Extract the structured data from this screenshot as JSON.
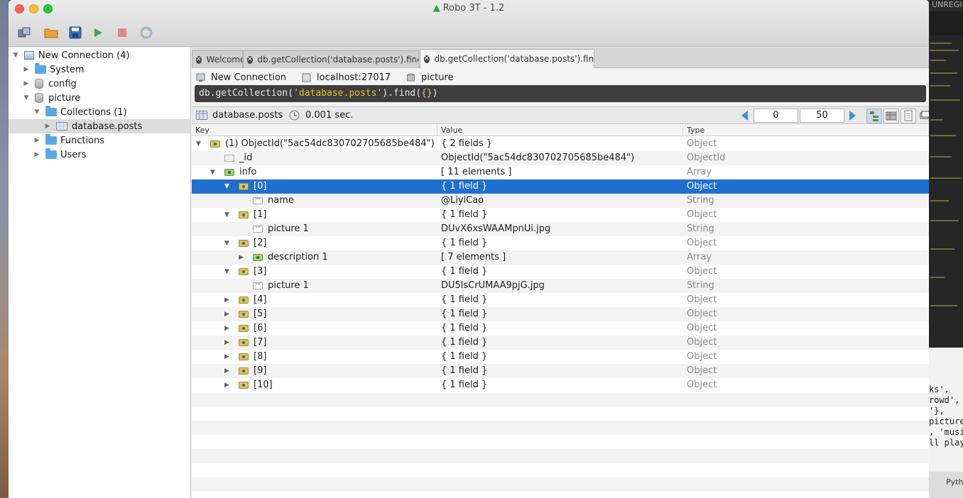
{
  "window": {
    "title": "Robo 3T - 1.2"
  },
  "desktop": {
    "top_right_text": "UNREGI",
    "code_snippets": [
      "ks',",
      "rowd',",
      "'},",
      "picture",
      ", 'musi",
      "ll playe"
    ],
    "bottom_right_text": "Pyth"
  },
  "toolbar": {
    "buttons": [
      "connect",
      "open",
      "save",
      "execute",
      "stop",
      "refresh"
    ]
  },
  "sidebar": {
    "items": [
      {
        "label": "New Connection (4)",
        "arrow": "▼",
        "icon": "computer-icon"
      },
      {
        "label": "System",
        "arrow": "▶",
        "icon": "folder-icon"
      },
      {
        "label": "config",
        "arrow": "▶",
        "icon": "database-icon"
      },
      {
        "label": "picture",
        "arrow": "▼",
        "icon": "database-icon"
      },
      {
        "label": "Collections (1)",
        "arrow": "▼",
        "icon": "folder-icon"
      },
      {
        "label": "database.posts",
        "arrow": "▶",
        "icon": "table-icon"
      },
      {
        "label": "Functions",
        "arrow": "▶",
        "icon": "folder-icon"
      },
      {
        "label": "Users",
        "arrow": "▶",
        "icon": "folder-icon"
      }
    ]
  },
  "tabs": [
    {
      "label": "Welcome"
    },
    {
      "label": "db.getCollection('database.posts').find({"
    },
    {
      "label": "db.getCollection('database.posts').find({"
    }
  ],
  "query": {
    "connection": "New Connection",
    "host": "localhost:27017",
    "database": "picture",
    "prefix": "db.getCollection(",
    "collection_arg": "'database.posts'",
    "suffix": ").find(",
    "braces": "{}",
    "close": ")"
  },
  "results": {
    "collection": "database.posts",
    "time": "0.001 sec.",
    "skip": "0",
    "limit": "50"
  },
  "grid": {
    "headers": {
      "key": "Key",
      "value": "Value",
      "type": "Type"
    },
    "rows": [
      {
        "key": "(1) ObjectId(\"5ac54dc830702705685be484\")",
        "value": "{ 2 fields }",
        "type": "Object"
      },
      {
        "key": "_id",
        "value": "ObjectId(\"5ac54dc830702705685be484\")",
        "type": "ObjectId"
      },
      {
        "key": "info",
        "value": "[ 11 elements ]",
        "type": "Array"
      },
      {
        "key": "[0]",
        "value": "{ 1 field }",
        "type": "Object"
      },
      {
        "key": "name",
        "value": "@LiyiCao",
        "type": "String"
      },
      {
        "key": "[1]",
        "value": "{ 1 field }",
        "type": "Object"
      },
      {
        "key": "picture 1",
        "value": "DUvX6xsWAAMpnUi.jpg",
        "type": "String"
      },
      {
        "key": "[2]",
        "value": "{ 1 field }",
        "type": "Object"
      },
      {
        "key": "description 1",
        "value": "[ 7 elements ]",
        "type": "Array"
      },
      {
        "key": "[3]",
        "value": "{ 1 field }",
        "type": "Object"
      },
      {
        "key": "picture 1",
        "value": "DU5lsCrUMAA9pjG.jpg",
        "type": "String"
      },
      {
        "key": "[4]",
        "value": "{ 1 field }",
        "type": "Object"
      },
      {
        "key": "[5]",
        "value": "{ 1 field }",
        "type": "Object"
      },
      {
        "key": "[6]",
        "value": "{ 1 field }",
        "type": "Object"
      },
      {
        "key": "[7]",
        "value": "{ 1 field }",
        "type": "Object"
      },
      {
        "key": "[8]",
        "value": "{ 1 field }",
        "type": "Object"
      },
      {
        "key": "[9]",
        "value": "{ 1 field }",
        "type": "Object"
      },
      {
        "key": "[10]",
        "value": "{ 1 field }",
        "type": "Object"
      }
    ]
  },
  "colors": {
    "selection": "#1f6fd0",
    "accent_green": "#2aa24a"
  }
}
